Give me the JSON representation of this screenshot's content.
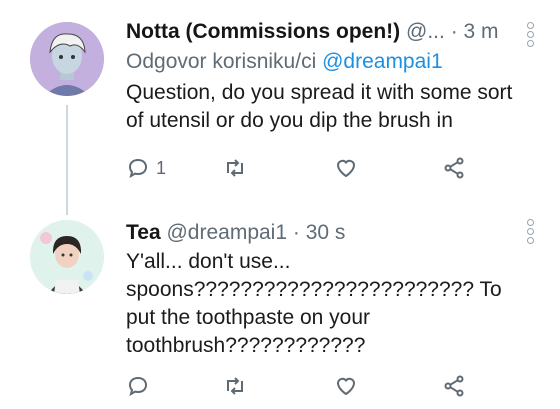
{
  "tweets": [
    {
      "name": "Notta (Commissions open!)",
      "handle": "@...",
      "time": "· 3 m",
      "reply_prefix": "Odgovor korisniku/ci",
      "reply_handle": "@dreampai1",
      "text": "Question, do you spread it with some sort of utensil or do you dip the brush in",
      "reply_count": "1",
      "icons": [
        "reply-icon",
        "retweet-icon",
        "like-icon",
        "share-icon",
        "more-icon"
      ]
    },
    {
      "name": "Tea",
      "handle": "@dreampai1",
      "time": "· 30 s",
      "text": "Y'all... don't use... spoons???????????????????????? To put the toothpaste on your toothbrush????????????",
      "reply_count": "",
      "icons": [
        "reply-icon",
        "retweet-icon",
        "like-icon",
        "share-icon",
        "more-icon"
      ]
    }
  ]
}
